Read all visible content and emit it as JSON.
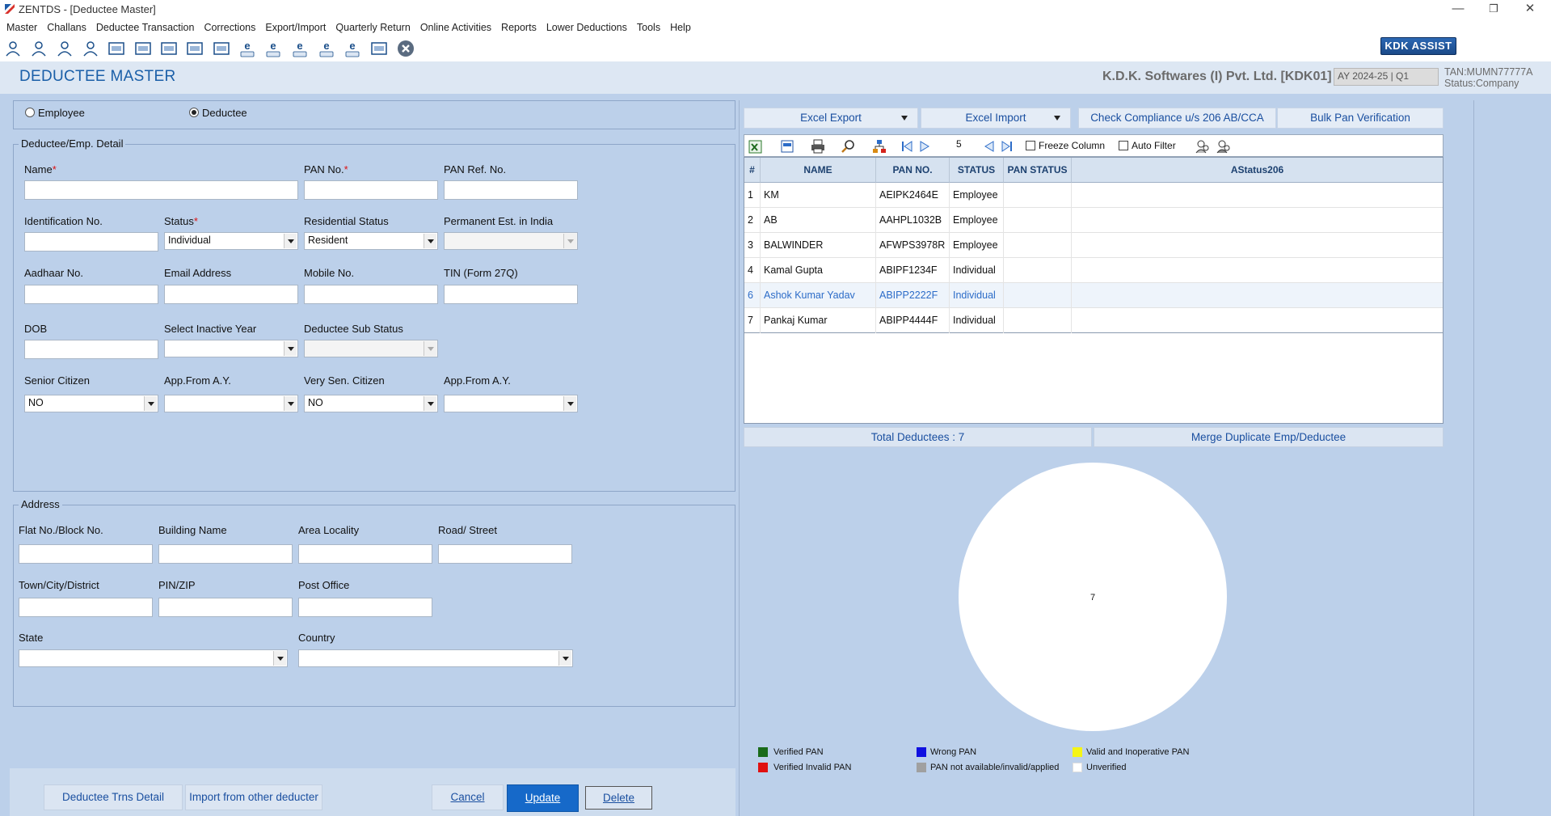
{
  "window": {
    "title": "ZENTDS - [Deductee Master]",
    "minimize": "—",
    "maximize": "❐",
    "close": "✕"
  },
  "menu": [
    "Master",
    "Challans",
    "Deductee Transaction",
    "Corrections",
    "Export/Import",
    "Quarterly Return",
    "Online Activities",
    "Reports",
    "Lower Deductions",
    "Tools",
    "Help"
  ],
  "toolbar": {
    "assist_label": "KDK ASSIST"
  },
  "header": {
    "page_title": "DEDUCTEE MASTER",
    "company": "K.D.K. Softwares (I) Pvt. Ltd. [KDK01]",
    "ay": "AY 2024-25 | Q1",
    "tan": "TAN:MUMN77777A",
    "status": "Status:Company"
  },
  "type_radio": {
    "employee": "Employee",
    "deductee": "Deductee",
    "selected": "deductee"
  },
  "detail": {
    "group_title": "Deductee/Emp. Detail",
    "name_label": "Name",
    "name_value": "",
    "pan_label": "PAN No.",
    "pan_value": "",
    "panref_label": "PAN Ref. No.",
    "panref_value": "",
    "idno_label": "Identification No.",
    "idno_value": "",
    "status_label": "Status",
    "status_value": "Individual",
    "resstatus_label": "Residential Status",
    "resstatus_value": "Resident",
    "permest_label": "Permanent Est. in India",
    "permest_value": "",
    "aadhaar_label": "Aadhaar No.",
    "aadhaar_value": "",
    "email_label": "Email Address",
    "email_value": "",
    "mobile_label": "Mobile No.",
    "mobile_value": "",
    "tin_label": "TIN (Form 27Q)",
    "tin_value": "",
    "dob_label": "DOB",
    "dob_value": "",
    "inactive_label": "Select Inactive Year",
    "inactive_value": "",
    "substatus_label": "Deductee Sub Status",
    "substatus_value": "",
    "senior_label": "Senior Citizen",
    "senior_value": "NO",
    "appfrom1_label": "App.From A.Y.",
    "appfrom1_value": "",
    "verysen_label": "Very Sen. Citizen",
    "verysen_value": "NO",
    "appfrom2_label": "App.From A.Y.",
    "appfrom2_value": ""
  },
  "address": {
    "group_title": "Address",
    "flat_label": "Flat No./Block No.",
    "flat_value": "",
    "building_label": "Building Name",
    "building_value": "",
    "area_label": "Area Locality",
    "area_value": "",
    "road_label": "Road/ Street",
    "road_value": "",
    "town_label": "Town/City/District",
    "town_value": "",
    "pin_label": "PIN/ZIP",
    "pin_value": "",
    "post_label": "Post Office",
    "post_value": "",
    "state_label": "State",
    "state_value": "",
    "country_label": "Country",
    "country_value": ""
  },
  "bottom_buttons": {
    "trns_detail": "Deductee Trns Detail",
    "import_other": "Import from other deducter",
    "cancel": "Cancel",
    "update": "Update",
    "delete": "Delete"
  },
  "right_buttons": {
    "excel_export": "Excel Export",
    "excel_import": "Excel Import",
    "check_compliance": "Check Compliance u/s 206 AB/CCA",
    "bulk_pan": "Bulk Pan Verification"
  },
  "grid_toolbar": {
    "page_value": "5",
    "freeze_column": "Freeze Column",
    "auto_filter": "Auto Filter"
  },
  "grid": {
    "columns": [
      "#",
      "NAME",
      "PAN NO.",
      "STATUS",
      "PAN STATUS",
      "AStatus206"
    ],
    "rows": [
      {
        "no": "1",
        "name": "KM",
        "pan": "AEIPK2464E",
        "status": "Employee",
        "pan_status": "",
        "astatus": ""
      },
      {
        "no": "2",
        "name": "AB",
        "pan": "AAHPL1032B",
        "status": "Employee",
        "pan_status": "",
        "astatus": ""
      },
      {
        "no": "3",
        "name": "BALWINDER",
        "pan": "AFWPS3978R",
        "status": "Employee",
        "pan_status": "",
        "astatus": ""
      },
      {
        "no": "4",
        "name": "Kamal Gupta",
        "pan": "ABIPF1234F",
        "status": "Individual",
        "pan_status": "",
        "astatus": ""
      },
      {
        "no": "6",
        "name": "Ashok Kumar Yadav",
        "pan": "ABIPP2222F",
        "status": "Individual",
        "pan_status": "",
        "astatus": ""
      },
      {
        "no": "7",
        "name": "Pankaj Kumar",
        "pan": "ABIPP4444F",
        "status": "Individual",
        "pan_status": "",
        "astatus": ""
      }
    ]
  },
  "summary": {
    "total": "Total Deductees : 7",
    "merge": "Merge Duplicate Emp/Deductee"
  },
  "chart_data": {
    "type": "pie",
    "slices": [
      {
        "label": "Unverified",
        "value": 7,
        "color": "#ffffff"
      }
    ],
    "center_label": "7"
  },
  "legend": [
    {
      "label": "Verified PAN",
      "color": "#1a6b1a"
    },
    {
      "label": "Verified Invalid PAN",
      "color": "#e01010"
    },
    {
      "label": "Wrong PAN",
      "color": "#1010e0"
    },
    {
      "label": "PAN not available/invalid/applied",
      "color": "#a0a0a0"
    },
    {
      "label": "Valid and Inoperative PAN",
      "color": "#f5f516"
    },
    {
      "label": "Unverified",
      "color": "#ffffff"
    }
  ]
}
